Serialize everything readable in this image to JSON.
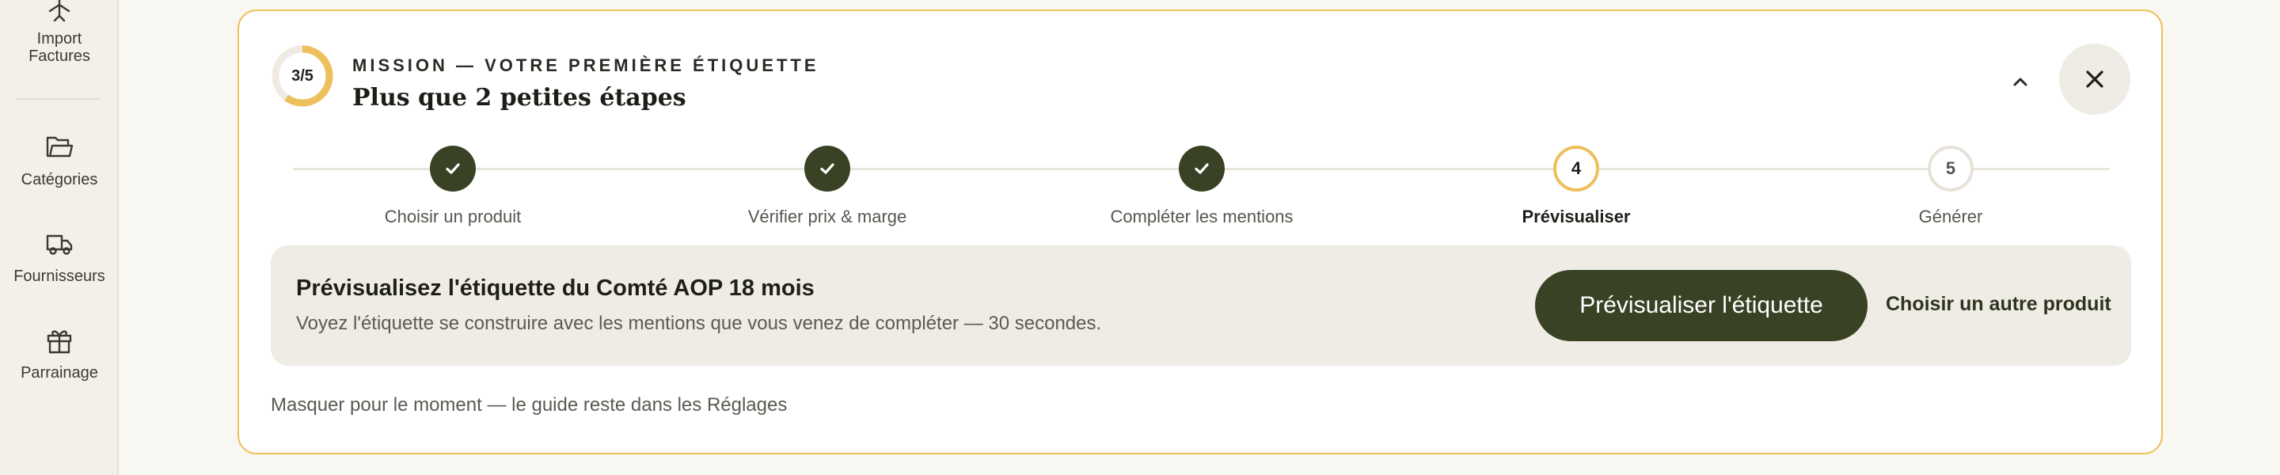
{
  "sidebar": {
    "items": [
      {
        "label": "Import\nFactures",
        "icon": "plane-icon"
      },
      {
        "label": "Catégories",
        "icon": "folder-icon"
      },
      {
        "label": "Fournisseurs",
        "icon": "truck-icon"
      },
      {
        "label": "Parrainage",
        "icon": "gift-icon"
      }
    ]
  },
  "mission": {
    "progress_text": "3/5",
    "progress_fraction": 0.6,
    "eyebrow": "MISSION — VOTRE PREMIÈRE ÉTIQUETTE",
    "title": "Plus que 2 petites étapes",
    "collapse_icon": "chevron-up-icon",
    "close_icon": "close-icon"
  },
  "steps": [
    {
      "label": "Choisir un produit",
      "state": "done",
      "marker": ""
    },
    {
      "label": "Vérifier prix & marge",
      "state": "done",
      "marker": ""
    },
    {
      "label": "Compléter les mentions",
      "state": "done",
      "marker": ""
    },
    {
      "label": "Prévisualiser",
      "state": "current",
      "marker": "4"
    },
    {
      "label": "Générer",
      "state": "todo",
      "marker": "5"
    }
  ],
  "action_panel": {
    "title": "Prévisualisez l'étiquette du Comté AOP 18 mois",
    "description": "Voyez l'étiquette se construire avec les mentions que vous venez de compléter — 30 secondes.",
    "primary_label": "Prévisualiser l'étiquette",
    "secondary_label": "Choisir un autre produit"
  },
  "dismiss_label": "Masquer pour le moment — le guide reste dans les Réglages",
  "colors": {
    "accent": "#ecc05c",
    "primary": "#394224",
    "panel_bg": "#efece5",
    "page_bg": "#f9f7f2"
  }
}
